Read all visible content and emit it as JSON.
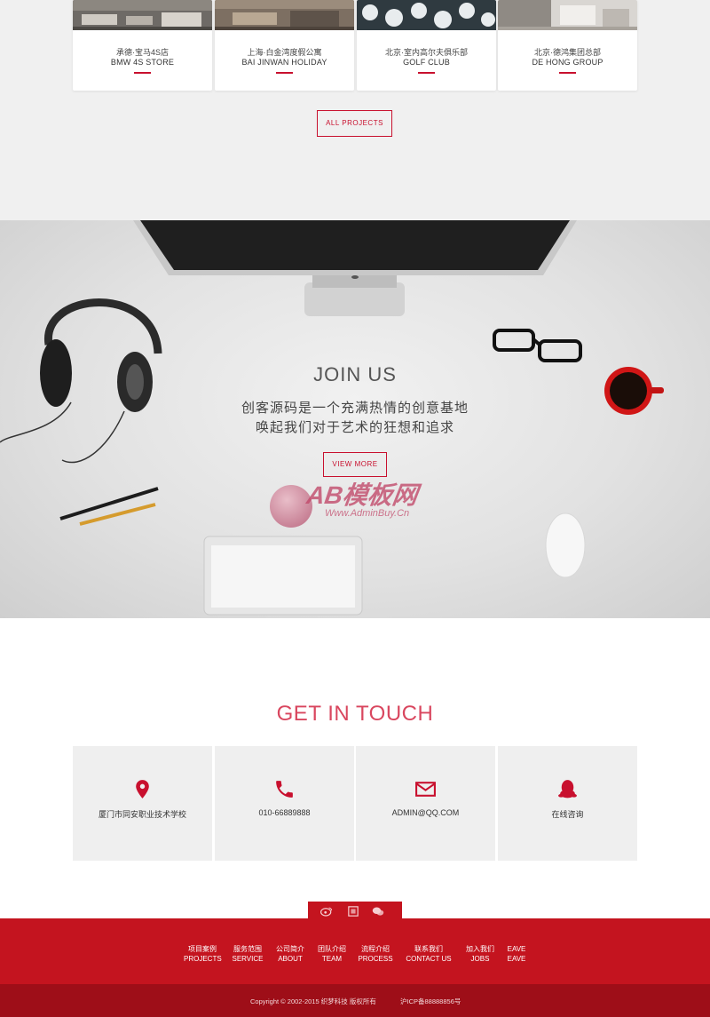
{
  "projects": {
    "cards": [
      {
        "cn": "承德·宝马4S店",
        "en": "BMW 4S STORE"
      },
      {
        "cn": "上海·白金湾度假公寓",
        "en": "BAI JINWAN HOLIDAY"
      },
      {
        "cn": "北京·室内高尔夫俱乐部",
        "en": "GOLF CLUB"
      },
      {
        "cn": "北京·德鸿集团总部",
        "en": "DE HONG GROUP"
      }
    ],
    "all_projects_label": "ALL PROJECTS"
  },
  "join": {
    "title": "JOIN US",
    "line1": "创客源码是一个充满热情的创意基地",
    "line2": "唤起我们对于艺术的狂想和追求",
    "view_more_label": "VIEW MORE",
    "watermark_main": "AB模板网",
    "watermark_sub": "Www.AdminBuy.Cn"
  },
  "touch": {
    "title": "GET IN TOUCH",
    "cards": [
      {
        "icon": "location-pin-icon",
        "text": "厦门市同安职业技术学校"
      },
      {
        "icon": "phone-icon",
        "text": "010-66889888"
      },
      {
        "icon": "mail-icon",
        "text": "ADMIN@QQ.COM"
      },
      {
        "icon": "qq-penguin-icon",
        "text": "在线咨询"
      }
    ]
  },
  "footer": {
    "nav": [
      {
        "cn": "项目案例",
        "en": "PROJECTS"
      },
      {
        "cn": "服务范围",
        "en": "SERVICE"
      },
      {
        "cn": "公司简介",
        "en": "ABOUT"
      },
      {
        "cn": "团队介绍",
        "en": "TEAM"
      },
      {
        "cn": "流程介绍",
        "en": "PROCESS"
      },
      {
        "cn": "联系我们",
        "en": "CONTACT US"
      },
      {
        "cn": "加入我们",
        "en": "JOBS"
      },
      {
        "cn": "EAVE",
        "en": "EAVE"
      }
    ],
    "copyright": "Copyright © 2002-2015 织梦科技 版权所有",
    "icp": "沪ICP备88888856号"
  },
  "colors": {
    "accent": "#c8102e",
    "footer": "#c4141f",
    "footer_bottom": "#9e0e18",
    "touch_title": "#d9475f"
  }
}
